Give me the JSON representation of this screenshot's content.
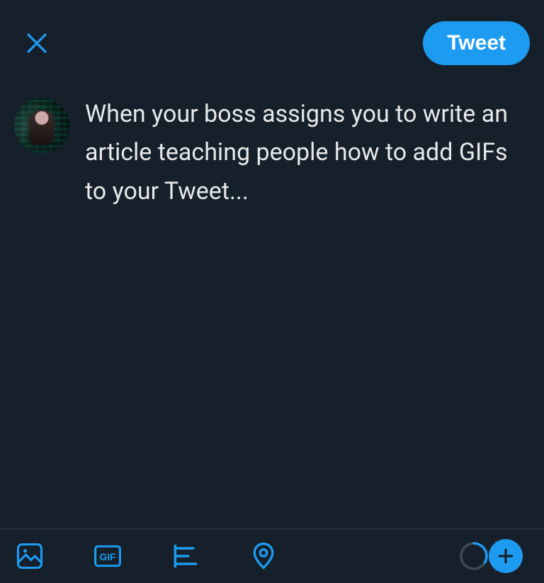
{
  "header": {
    "tweet_label": "Tweet"
  },
  "compose": {
    "text": "When your boss assigns you to write an article teaching people how to add GIFs to your Tweet..."
  },
  "toolbar": {
    "gif_label": "GIF"
  },
  "colors": {
    "accent": "#1d9bf0",
    "bg": "#15202b"
  }
}
